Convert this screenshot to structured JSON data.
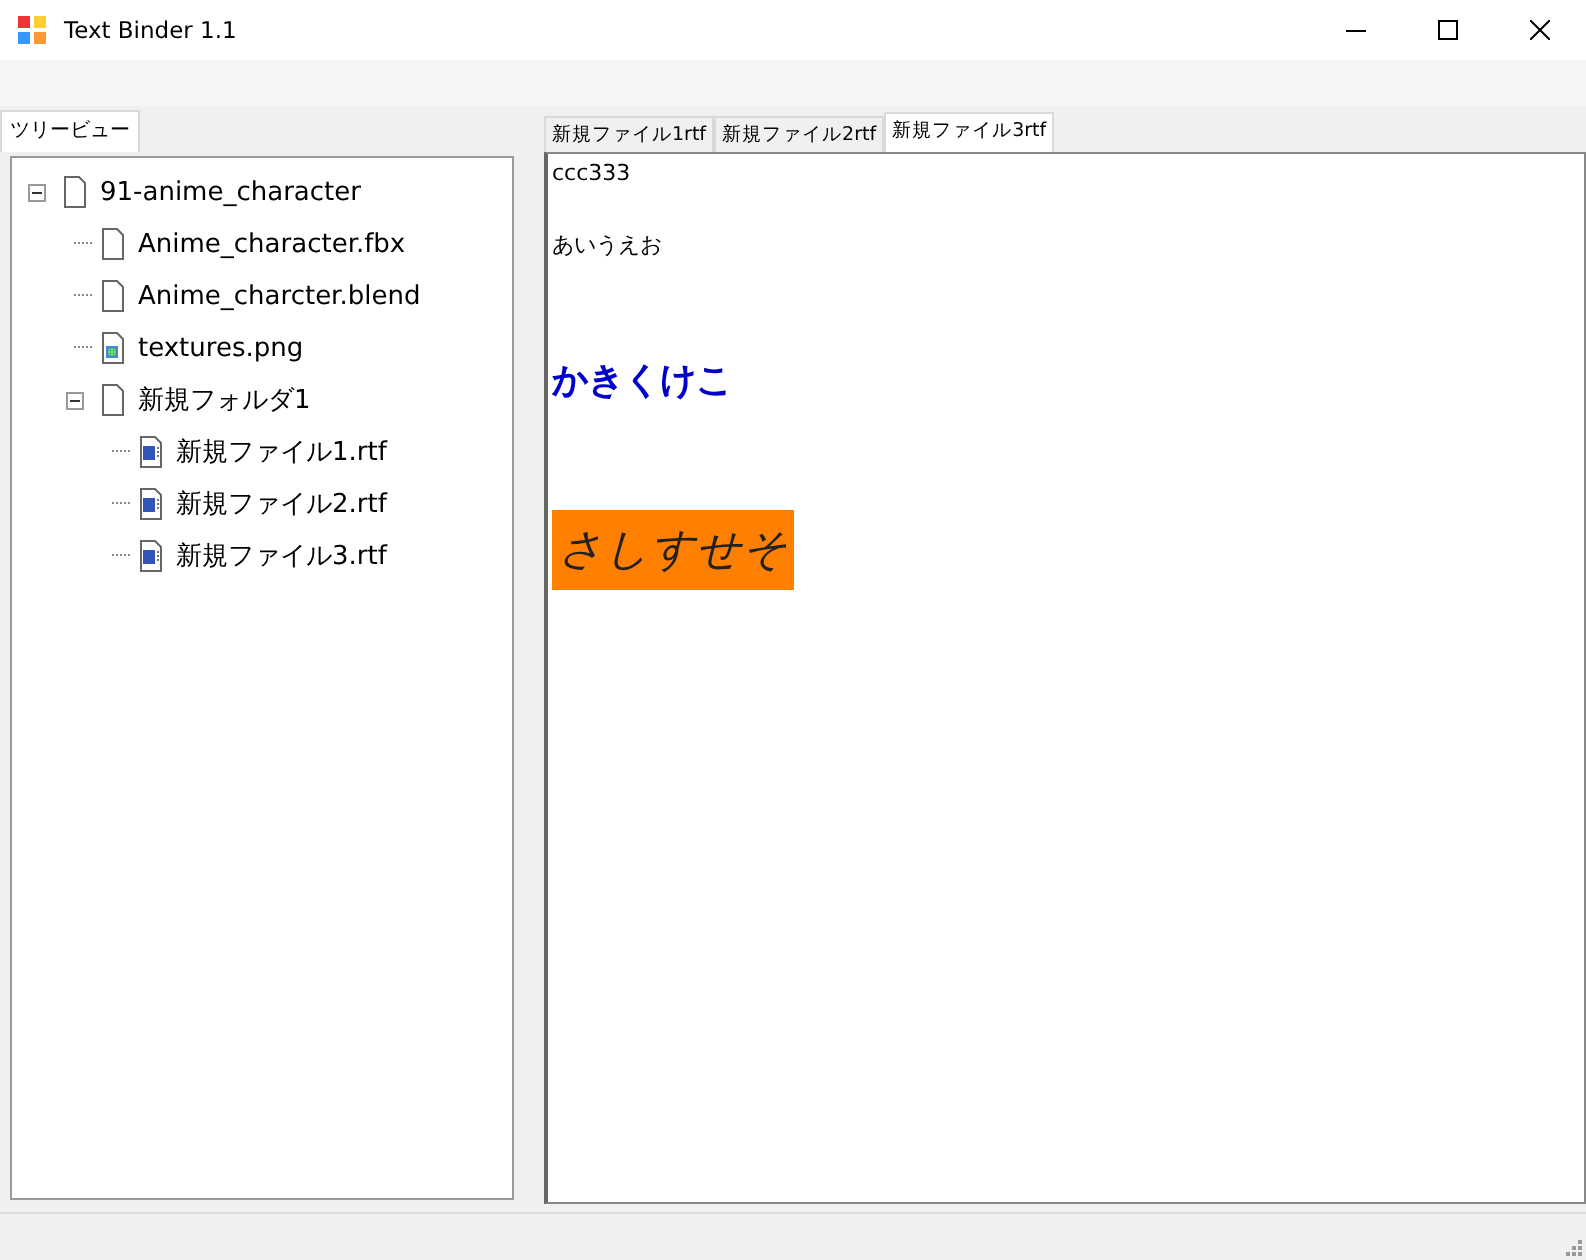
{
  "window": {
    "title": "Text Binder 1.1"
  },
  "tree_panel": {
    "tab": {
      "label": "ツリービュー",
      "selected": true
    },
    "tree": [
      {
        "label": "91-anime_character",
        "kind": "file",
        "expanded": true,
        "children": [
          {
            "label": "Anime_character.fbx",
            "kind": "file"
          },
          {
            "label": "Anime_charcter.blend",
            "kind": "file"
          },
          {
            "label": "textures.png",
            "kind": "image"
          },
          {
            "label": "新規フォルダ1",
            "kind": "file",
            "expanded": true,
            "children": [
              {
                "label": "新規ファイル1.rtf",
                "kind": "document"
              },
              {
                "label": "新規ファイル2.rtf",
                "kind": "document"
              },
              {
                "label": "新規ファイル3.rtf",
                "kind": "document"
              }
            ]
          }
        ]
      }
    ]
  },
  "editor": {
    "tabs": [
      {
        "label": "新規ファイル1rtf",
        "selected": false
      },
      {
        "label": "新規ファイル2rtf",
        "selected": false
      },
      {
        "label": "新規ファイル3rtf",
        "selected": true
      }
    ],
    "paragraphs": [
      {
        "text": "ccc333",
        "kind": "plain"
      },
      {
        "text": "あいうえお",
        "kind": "plain"
      },
      {
        "text": "かきくけこ",
        "kind": "heading"
      },
      {
        "text": "さしすせそ",
        "kind": "highlight"
      }
    ]
  }
}
